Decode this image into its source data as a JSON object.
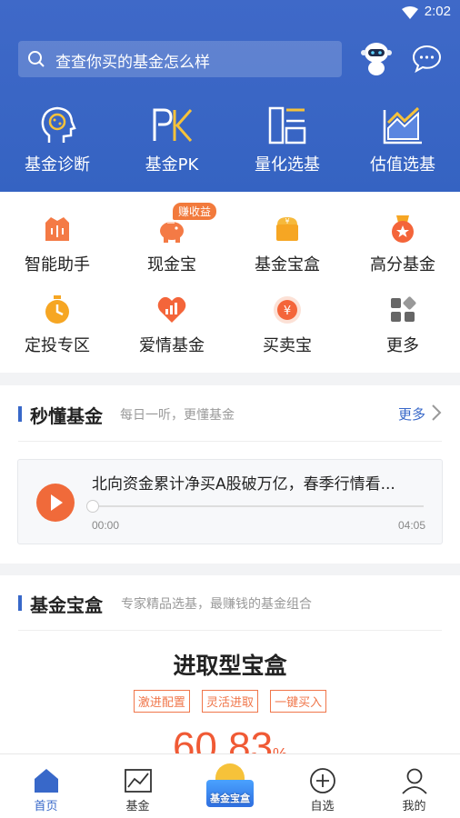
{
  "status": {
    "time": "2:02"
  },
  "search": {
    "placeholder": "查查你买的基金怎么样"
  },
  "topnav": [
    {
      "label": "基金诊断",
      "icon": "brain-head-icon"
    },
    {
      "label": "基金PK",
      "icon": "pk-icon"
    },
    {
      "label": "量化选基",
      "icon": "quant-chart-icon"
    },
    {
      "label": "估值选基",
      "icon": "valuation-chart-icon"
    }
  ],
  "grid": [
    {
      "label": "智能助手",
      "icon": "assistant-icon"
    },
    {
      "label": "现金宝",
      "icon": "piggy-bank-icon",
      "badge": "赚收益"
    },
    {
      "label": "基金宝盒",
      "icon": "treasure-box-icon"
    },
    {
      "label": "高分基金",
      "icon": "medal-icon"
    },
    {
      "label": "定投专区",
      "icon": "stopwatch-icon"
    },
    {
      "label": "爱情基金",
      "icon": "heart-chart-icon"
    },
    {
      "label": "买卖宝",
      "icon": "exchange-icon"
    },
    {
      "label": "更多",
      "icon": "more-grid-icon"
    }
  ],
  "section_audio": {
    "title": "秒懂基金",
    "subtitle": "每日一听，更懂基金",
    "more": "更多",
    "track_title": "北向资金累计净买A股破万亿，春季行情看...",
    "time_start": "00:00",
    "time_end": "04:05",
    "progress": 0
  },
  "section_box": {
    "title": "基金宝盒",
    "subtitle": "专家精品选基，最赚钱的基金组合",
    "box_name": "进取型宝盒",
    "tags": [
      "激进配置",
      "灵活进取",
      "一键买入"
    ],
    "return_value": "60.83",
    "return_unit": "%"
  },
  "tabbar": [
    {
      "label": "首页",
      "icon": "home-icon",
      "active": true
    },
    {
      "label": "基金",
      "icon": "line-chart-icon"
    },
    {
      "label": "基金宝盒",
      "icon": "treasure-box-icon"
    },
    {
      "label": "自选",
      "icon": "plus-circle-icon"
    },
    {
      "label": "我的",
      "icon": "user-icon"
    }
  ],
  "colors": {
    "primary": "#3868c9",
    "accent": "#f06a3a",
    "header": "#3f69c8"
  }
}
